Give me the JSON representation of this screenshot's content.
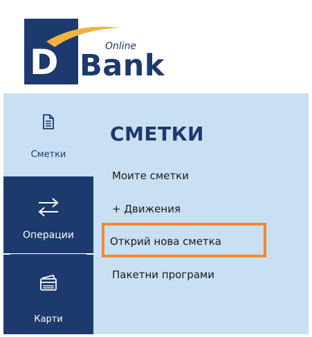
{
  "logo": {
    "d_letter": "D",
    "bank_text": "Bank",
    "online_text": "Online"
  },
  "rail": {
    "items": [
      {
        "label": "Сметки",
        "icon": "document-icon",
        "state": "active"
      },
      {
        "label": "Операции",
        "icon": "swap-arrows-icon",
        "state": "inactive"
      },
      {
        "label": "Карти",
        "icon": "card-icon",
        "state": "inactive"
      }
    ]
  },
  "panel": {
    "title": "СМЕТКИ",
    "menu": [
      {
        "label": "Моите сметки"
      },
      {
        "label": "+ Движения"
      },
      {
        "label": "Открий нова сметка",
        "highlighted": true
      },
      {
        "label": "Пакетни програми"
      }
    ]
  },
  "colors": {
    "brand_navy": "#1c3a6e",
    "panel_light_blue": "#c9dff3",
    "swoosh_gold": "#f2b33d",
    "highlight_orange": "#f28a2e"
  }
}
